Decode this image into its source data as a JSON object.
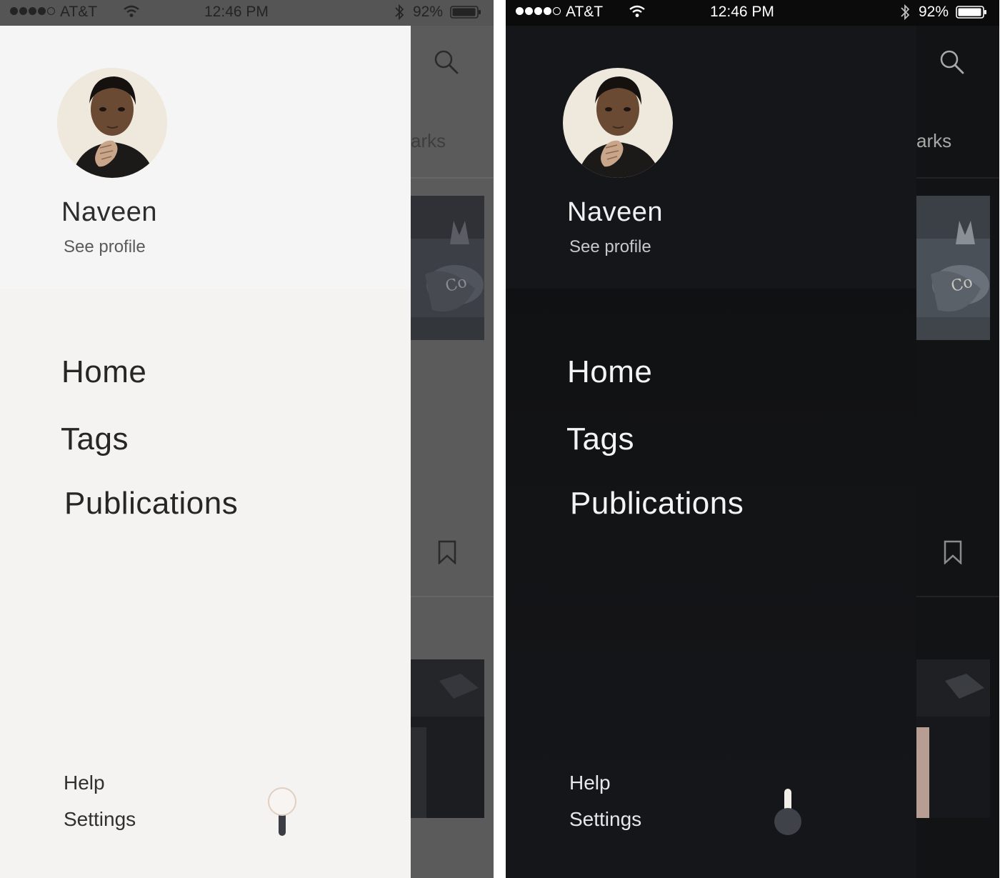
{
  "status_bar": {
    "carrier": "AT&T",
    "time": "12:46 PM",
    "battery": "92%",
    "signal_icon": "signal-dots-icon",
    "wifi_icon": "wifi-icon",
    "bluetooth_icon": "bluetooth-icon",
    "battery_icon": "battery-icon"
  },
  "drawer": {
    "user_name": "Naveen",
    "see_profile": "See profile",
    "nav": [
      {
        "label": "Home"
      },
      {
        "label": "Tags"
      },
      {
        "label": "Publications"
      }
    ],
    "footer": {
      "help": "Help",
      "settings": "Settings"
    },
    "theme_toggle_icon": "theme-switch-icon"
  },
  "background_app": {
    "tab_partial": "arks",
    "search_icon": "search-icon",
    "bookmark_icon": "bookmark-icon"
  },
  "themes": {
    "light": {
      "drawer_bg": "#f4f3f2",
      "text": "#262626",
      "overlay": "#5b5b5b"
    },
    "dark": {
      "drawer_bg": "#131416",
      "text": "#f4f4f4",
      "overlay": "#121315"
    }
  }
}
